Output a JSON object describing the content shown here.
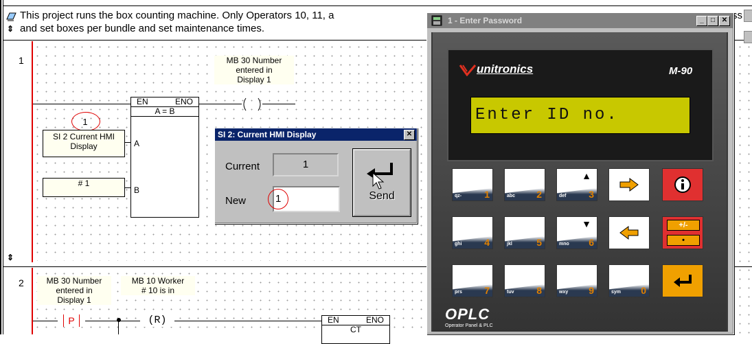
{
  "header": {
    "comment_line1": "This project runs the box counting machine. Only Operators 10, 11, a",
    "comment_line2": "and set boxes per bundle and set maintenance times.",
    "overflow_text": "ss"
  },
  "rung1": {
    "number": "1",
    "coil_comment": [
      "MB 30 Number",
      "entered in",
      "Display 1"
    ],
    "block": {
      "en": "EN",
      "eno": "ENO",
      "op": "A = B",
      "in_a": "A",
      "in_b": "B"
    },
    "operand_a_value": "1",
    "operand_a_label": [
      "SI 2 Current HMI",
      "Display"
    ],
    "operand_b_label": "# 1"
  },
  "rung2": {
    "number": "2",
    "comment1": [
      "MB 30 Number",
      "entered in",
      "Display 1"
    ],
    "comment2": [
      "MB 10 Worker",
      "# 10 is in"
    ],
    "contact": "P",
    "coil": "R",
    "block": {
      "en": "EN",
      "eno": "ENO",
      "op": "CT"
    }
  },
  "hmi_dialog": {
    "title": "SI 2: Current HMI Display",
    "current_label": "Current",
    "current_value": "1",
    "new_label": "New",
    "new_value": "1",
    "send_label": "Send"
  },
  "password_window": {
    "title": "1 - Enter Password",
    "brand": "unitronics",
    "model": "M-90",
    "display_text": "Enter ID no.",
    "footer_logo": "OPLC",
    "footer_sub": "Operator Panel & PLC",
    "keys": [
      {
        "label": "qz-",
        "num": "1"
      },
      {
        "label": "abc",
        "num": "2"
      },
      {
        "label": "def",
        "num": "3"
      },
      {
        "label": "ghi",
        "num": "4"
      },
      {
        "label": "jkl",
        "num": "5"
      },
      {
        "label": "mno",
        "num": "6"
      },
      {
        "label": "prs",
        "num": "7"
      },
      {
        "label": "tuv",
        "num": "8"
      },
      {
        "label": "wxy",
        "num": "9"
      },
      {
        "label": "sym",
        "num": "0"
      }
    ],
    "plusminus": "+/-",
    "dot": "•"
  }
}
